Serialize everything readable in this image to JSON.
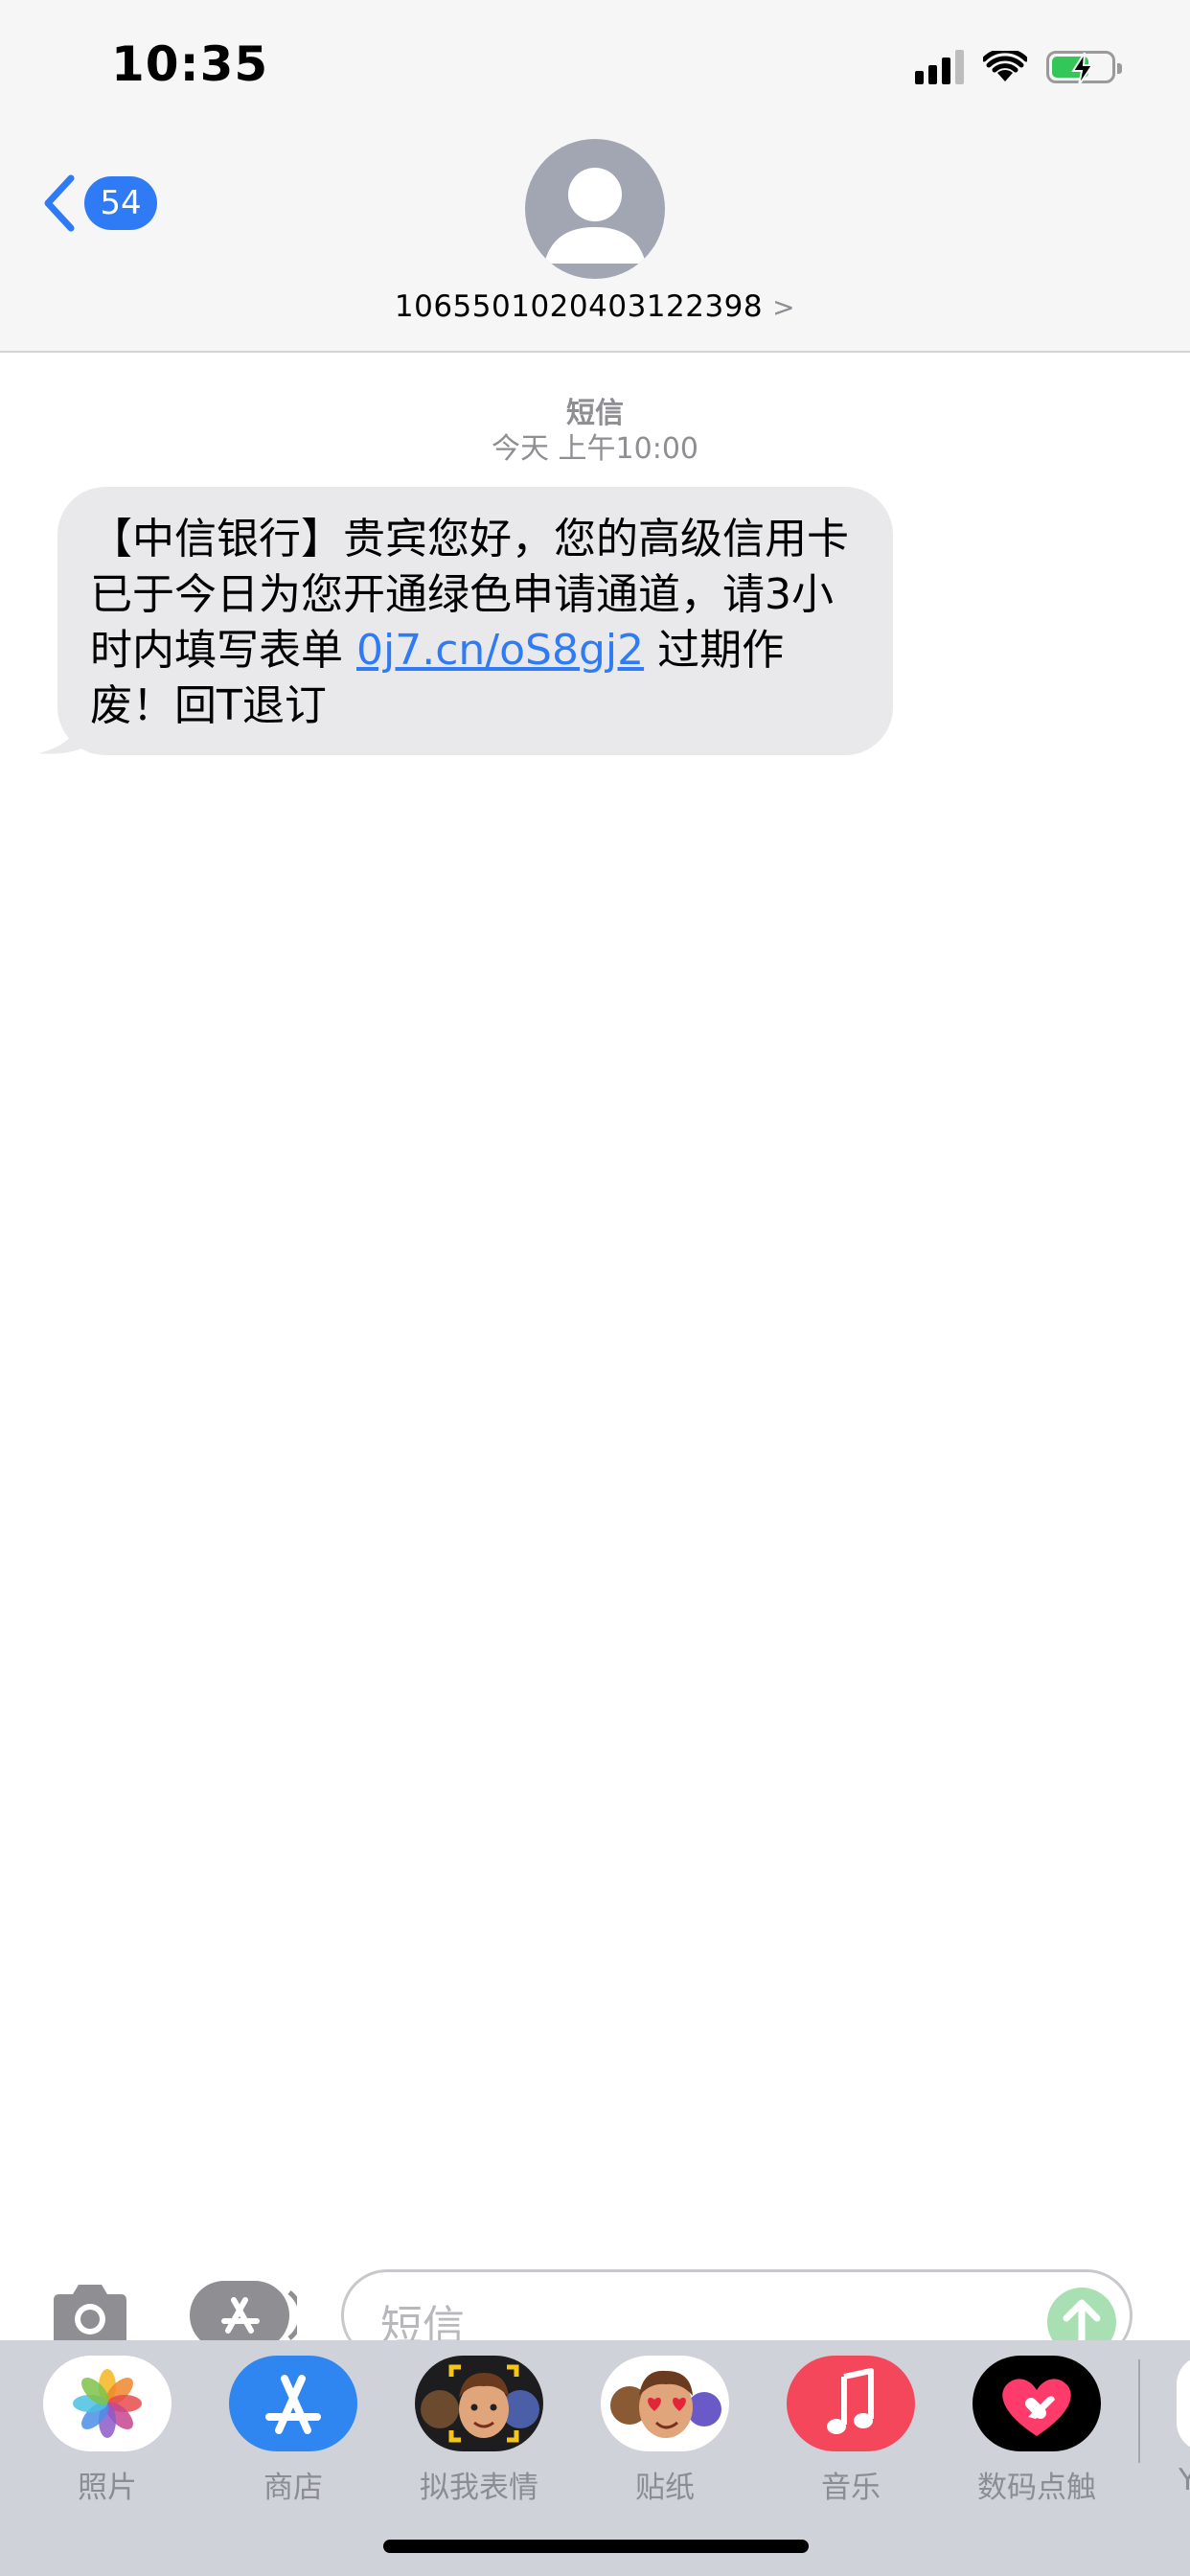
{
  "status_bar": {
    "time": "10:35"
  },
  "header": {
    "back_badge": "54",
    "contact": "1065501020403122398",
    "chevron": ">"
  },
  "conversation": {
    "service_label": "短信",
    "timestamp": "今天 上午10:00",
    "message": {
      "text_before_link": "【中信银行】贵宾您好，您的高级信用卡已于今日为您开通绿色申请通道，请3小时内填写表单 ",
      "link_text": "0j7.cn/oS8gj2",
      "text_after_link": " 过期作废！回T退订"
    }
  },
  "input_bar": {
    "placeholder": "短信"
  },
  "app_drawer": {
    "apps": [
      {
        "label": "照片",
        "icon": "photos-icon"
      },
      {
        "label": "商店",
        "icon": "app-store-icon"
      },
      {
        "label": "拟我表情",
        "icon": "memoji-icon"
      },
      {
        "label": "贴纸",
        "icon": "stickers-icon"
      },
      {
        "label": "音乐",
        "icon": "music-icon"
      },
      {
        "label": "数码点触",
        "icon": "digital-touch-icon"
      }
    ],
    "partial_label": "Y"
  },
  "colors": {
    "accent_blue": "#2f7bf6",
    "bubble_gray": "#e9e9eb",
    "battery_green": "#33c759",
    "send_green": "#a8e0b3"
  }
}
